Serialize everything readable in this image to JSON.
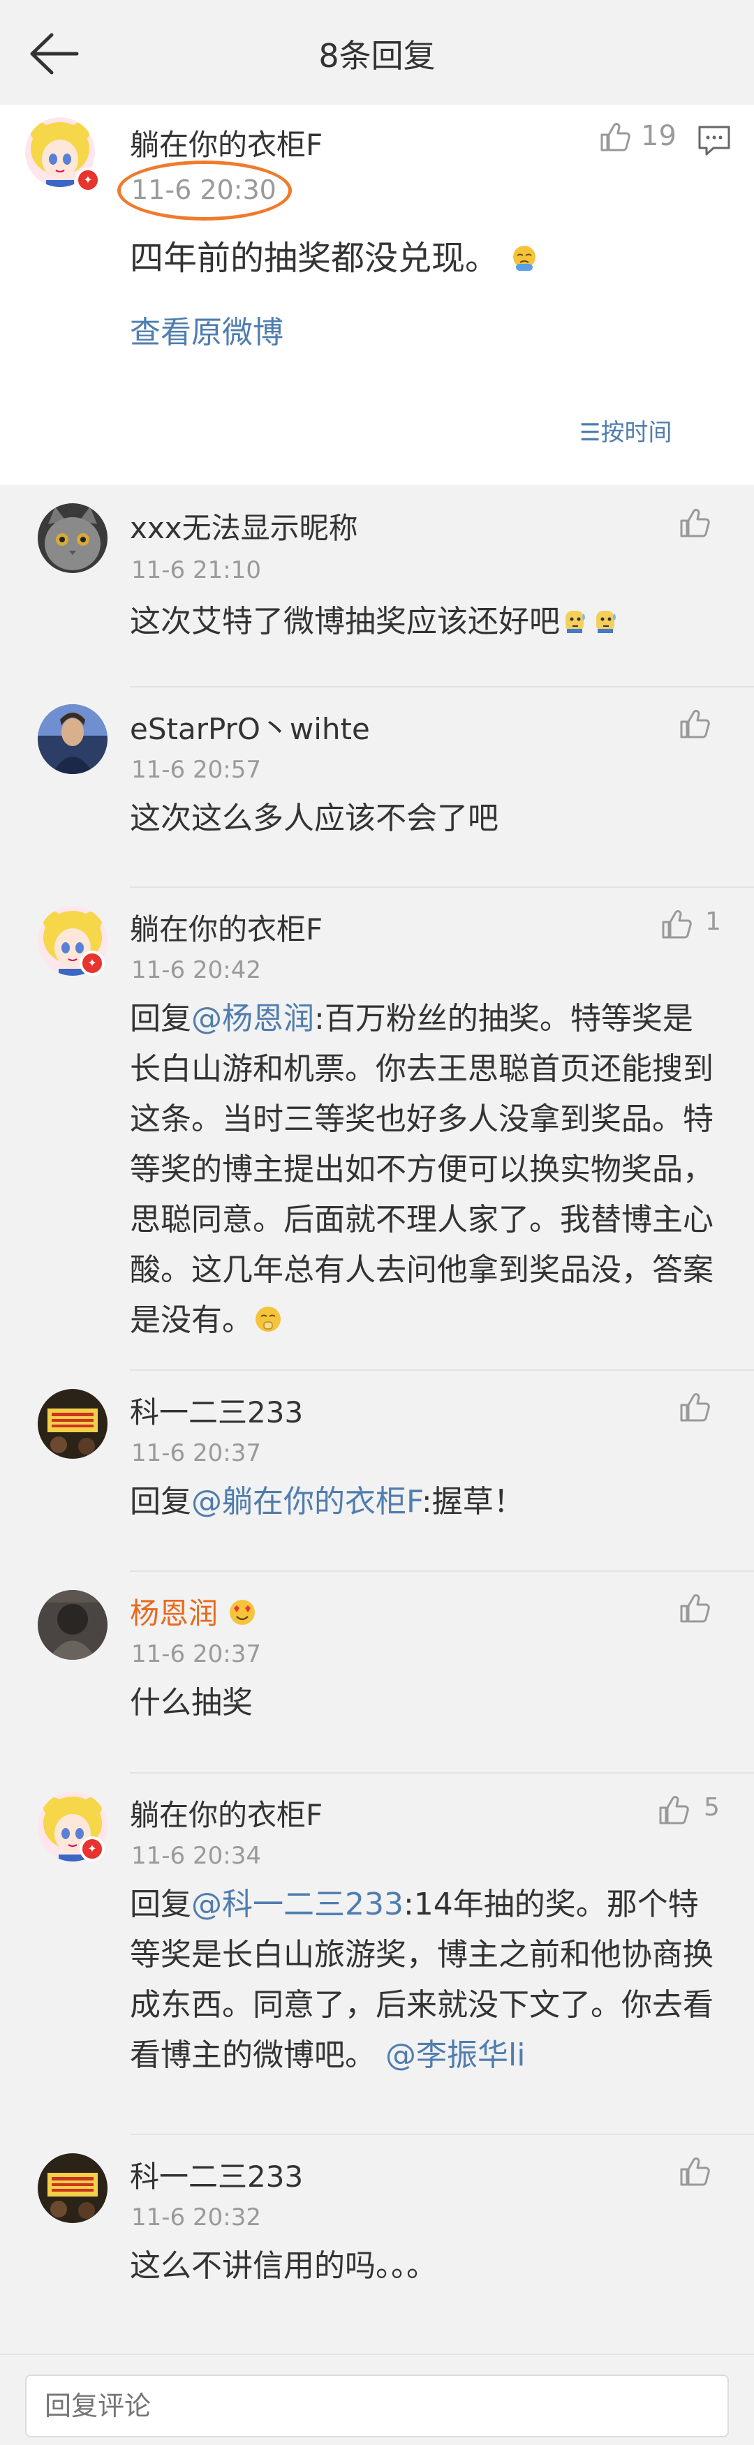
{
  "header": {
    "title": "8条回复"
  },
  "main": {
    "username": "躺在你的衣柜F",
    "time": "11-6 20:30",
    "likes": "19",
    "text": "四年前的抽奖都没兑现。",
    "view_original": "查看原微博",
    "sort_label": "按时间",
    "sort_icon": "sort-icon"
  },
  "comments": [
    {
      "username": "xxx无法显示昵称",
      "time": "11-6 21:10",
      "text": "这次艾特了微博抽奖应该还好吧",
      "avatar": "cat"
    },
    {
      "username": "eStarPrO丶wihte",
      "time": "11-6 20:57",
      "text": "这次这么多人应该不会了吧",
      "avatar": "person"
    },
    {
      "username": "躺在你的衣柜F",
      "time": "11-6 20:42",
      "likes": "1",
      "reply_prefix": "回复",
      "mention": "@杨恩润",
      "text": ":百万粉丝的抽奖。特等奖是长白山游和机票。你去王思聪首页还能搜到这条。当时三等奖也好多人没拿到奖品。特等奖的博主提出如不方便可以换实物奖品，思聪同意。后面就不理人家了。我替博主心酸。这几年总有人去问他拿到奖品没，答案是没有。",
      "avatar": "sailor"
    },
    {
      "username": "科一二三233",
      "time": "11-6 20:37",
      "reply_prefix": "回复",
      "mention": "@躺在你的衣柜F",
      "text": ":握草！",
      "avatar": "sign"
    },
    {
      "username": "杨恩润",
      "time": "11-6 20:37",
      "text": "什么抽奖",
      "avatar": "dark"
    },
    {
      "username": "躺在你的衣柜F",
      "time": "11-6 20:34",
      "likes": "5",
      "reply_prefix": "回复",
      "mention": "@科一二三233",
      "text": ":14年抽的奖。那个特等奖是长白山旅游奖，博主之前和他协商换成东西。同意了，后来就没下文了。你去看看博主的微博吧。",
      "mention2": "@李振华li",
      "avatar": "sailor"
    },
    {
      "username": "科一二三233",
      "time": "11-6 20:32",
      "text": "这么不讲信用的吗。。。",
      "avatar": "sign"
    }
  ],
  "footer": {
    "placeholder": "回复评论"
  },
  "colors": {
    "link": "#507daf",
    "orange_name": "#e86a1e",
    "circle": "#f07b2c",
    "badge": "#e8332e"
  }
}
